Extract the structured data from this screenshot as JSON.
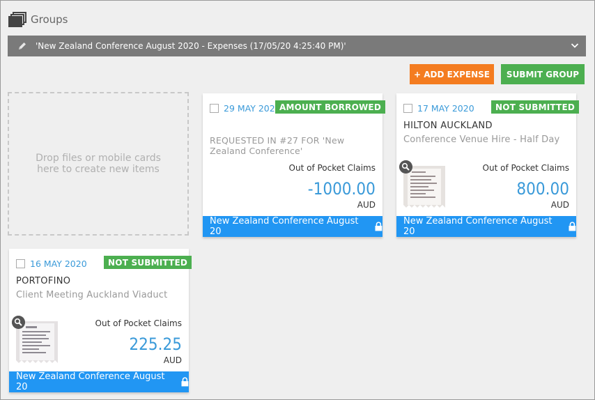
{
  "header": {
    "title": "Groups"
  },
  "group": {
    "title": "'New Zealand Conference August 2020 - Expenses (17/05/20 4:25:40 PM)'"
  },
  "buttons": {
    "add_expense": "+ ADD EXPENSE",
    "submit_group": "SUBMIT GROUP"
  },
  "dropzone": {
    "text_line1": "Drop files or mobile cards",
    "text_line2": "here to create new items"
  },
  "cards": [
    {
      "date": "29 MAY 2020",
      "badge": "AMOUNT BORROWED",
      "merchant": "",
      "description": "REQUESTED IN #27 FOR 'New Zealand Conference'",
      "category": "Out of Pocket Claims",
      "amount": "-1000.00",
      "currency": "AUD",
      "group": "New Zealand Conference August 20",
      "has_receipt": false
    },
    {
      "date": "17 MAY 2020",
      "badge": "NOT SUBMITTED",
      "merchant": "HILTON AUCKLAND",
      "description": "Conference Venue Hire - Half Day",
      "category": "Out of Pocket Claims",
      "amount": "800.00",
      "currency": "AUD",
      "group": "New Zealand Conference August 20",
      "has_receipt": true
    },
    {
      "date": "16 MAY 2020",
      "badge": "NOT SUBMITTED",
      "merchant": "PORTOFINO",
      "description": "Client Meeting Auckland Viaduct",
      "category": "Out of Pocket Claims",
      "amount": "225.25",
      "currency": "AUD",
      "group": "New Zealand Conference August 20",
      "has_receipt": true
    }
  ],
  "colors": {
    "accent_blue": "#2196f3",
    "date_blue": "#3a9ad9",
    "badge_green": "#4caf50",
    "add_orange": "#f47c20",
    "group_bar": "#7a7a7a"
  }
}
